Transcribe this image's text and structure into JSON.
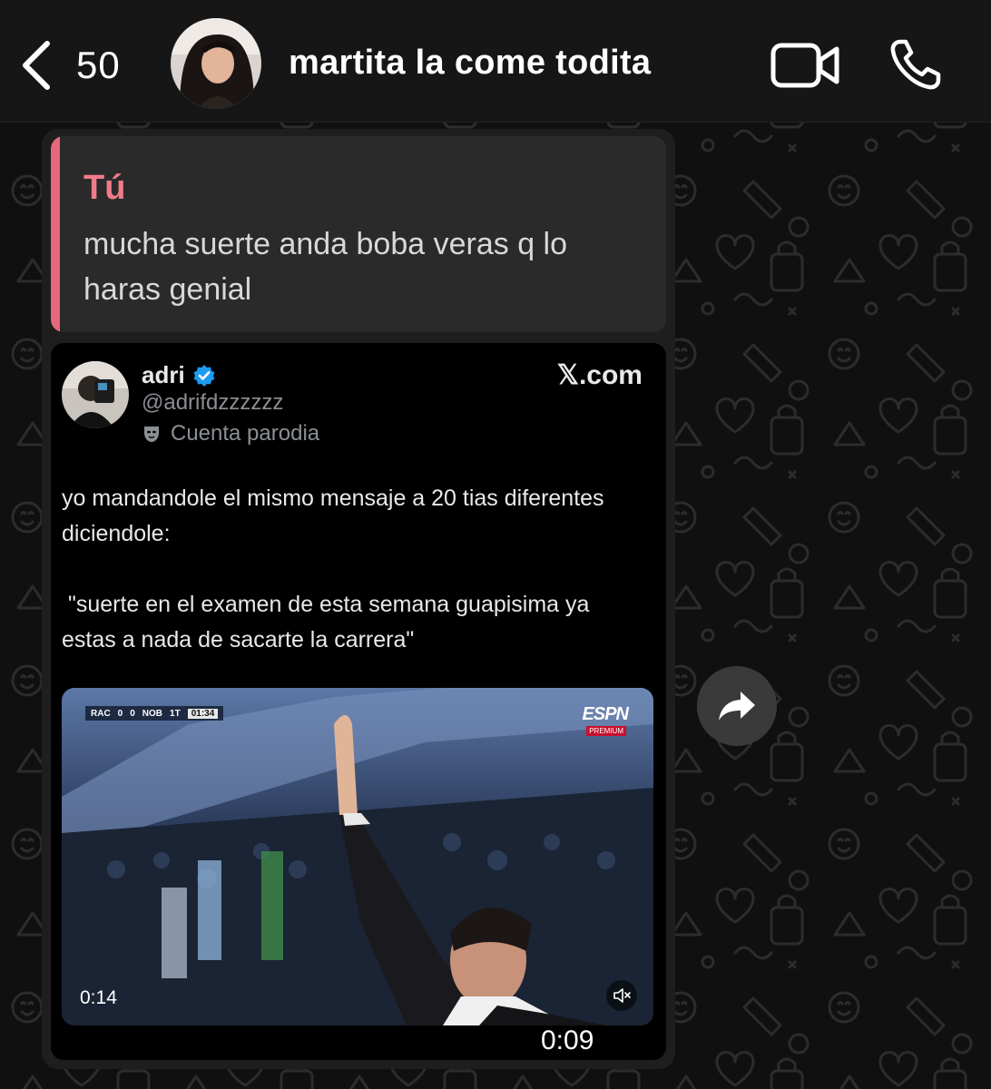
{
  "header": {
    "back_count": "50",
    "contact_name": "martita la come todita"
  },
  "message": {
    "quote": {
      "author": "Tú",
      "text": "mucha suerte anda boba veras q lo haras genial"
    },
    "link_preview": {
      "site": "𝕏.com",
      "author_name": "adri",
      "author_handle": "@adrifdzzzzzz",
      "account_label": "Cuenta parodia",
      "post_text": "yo mandandole el mismo mensaje a 20 tias diferentes diciendole:\n\n \"suerte en el examen de esta semana guapisima ya estas a nada de sacarte la carrera\"",
      "video": {
        "duration": "0:14",
        "scorebug": {
          "home": "RAC",
          "home_score": "0",
          "away_score": "0",
          "away": "NOB",
          "period": "1T",
          "clock": "01:34"
        },
        "broadcaster": "ESPN",
        "broadcaster_sub": "PREMIUM"
      }
    },
    "media_duration": "0:09"
  },
  "colors": {
    "header_bg": "#161616",
    "bubble_bg": "#1e1e1e",
    "quote_bg": "#2a2a2a",
    "quote_accent": "#e6687a",
    "card_bg": "#000000",
    "verified": "#1d9bf0",
    "forward_bg": "#3a3a3a"
  },
  "icons": {
    "back": "chevron-left-icon",
    "video_call": "video-camera-icon",
    "voice_call": "phone-icon",
    "verified": "verified-badge-icon",
    "parody": "mask-icon",
    "mute": "speaker-muted-icon",
    "forward": "forward-arrow-icon"
  }
}
